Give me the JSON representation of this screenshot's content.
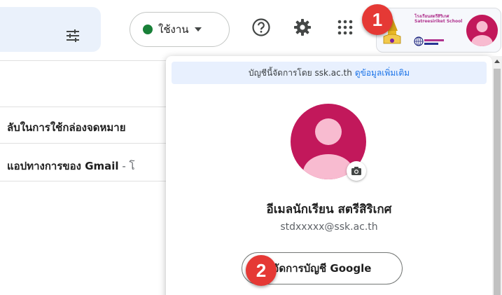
{
  "header": {
    "status_label": "ใช้งาน",
    "status_color": "#188038",
    "icons": [
      "filter-settings-icon",
      "help-icon",
      "gear-icon",
      "apps-grid-icon",
      "camera-icon"
    ],
    "school_logo_text": "โรงเรียนสตรีสิริเกศ Satreesiriket School"
  },
  "mail_list": {
    "rows": [
      {
        "subject": "ลับในการใช้กล่องจดหมาย",
        "snippet": ""
      },
      {
        "subject": "แอปทางการของ Gmail",
        "snippet": " - โ"
      }
    ]
  },
  "popup": {
    "managed_text": "บัญชีนี้จัดการโดย ssk.ac.th",
    "managed_link": "ดูข้อมูลเพิ่มเติม",
    "account_name": "อีเมลนักเรียน สตรีสิริเกศ",
    "account_email": "stdxxxxx@ssk.ac.th",
    "manage_button": "จัดการบัญชี Google"
  },
  "markers": {
    "one": "1",
    "two": "2"
  },
  "colors": {
    "avatar": "#c2185b",
    "marker": "#e53935",
    "link": "#1a73e8"
  }
}
